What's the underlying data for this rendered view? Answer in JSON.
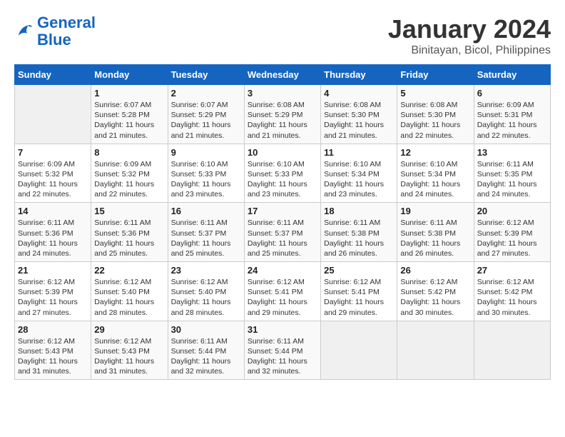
{
  "header": {
    "logo_line1": "General",
    "logo_line2": "Blue",
    "title": "January 2024",
    "subtitle": "Binitayan, Bicol, Philippines"
  },
  "days_of_week": [
    "Sunday",
    "Monday",
    "Tuesday",
    "Wednesday",
    "Thursday",
    "Friday",
    "Saturday"
  ],
  "weeks": [
    [
      {
        "num": "",
        "content": ""
      },
      {
        "num": "1",
        "content": "Sunrise: 6:07 AM\nSunset: 5:28 PM\nDaylight: 11 hours\nand 21 minutes."
      },
      {
        "num": "2",
        "content": "Sunrise: 6:07 AM\nSunset: 5:29 PM\nDaylight: 11 hours\nand 21 minutes."
      },
      {
        "num": "3",
        "content": "Sunrise: 6:08 AM\nSunset: 5:29 PM\nDaylight: 11 hours\nand 21 minutes."
      },
      {
        "num": "4",
        "content": "Sunrise: 6:08 AM\nSunset: 5:30 PM\nDaylight: 11 hours\nand 21 minutes."
      },
      {
        "num": "5",
        "content": "Sunrise: 6:08 AM\nSunset: 5:30 PM\nDaylight: 11 hours\nand 22 minutes."
      },
      {
        "num": "6",
        "content": "Sunrise: 6:09 AM\nSunset: 5:31 PM\nDaylight: 11 hours\nand 22 minutes."
      }
    ],
    [
      {
        "num": "7",
        "content": "Sunrise: 6:09 AM\nSunset: 5:32 PM\nDaylight: 11 hours\nand 22 minutes."
      },
      {
        "num": "8",
        "content": "Sunrise: 6:09 AM\nSunset: 5:32 PM\nDaylight: 11 hours\nand 22 minutes."
      },
      {
        "num": "9",
        "content": "Sunrise: 6:10 AM\nSunset: 5:33 PM\nDaylight: 11 hours\nand 23 minutes."
      },
      {
        "num": "10",
        "content": "Sunrise: 6:10 AM\nSunset: 5:33 PM\nDaylight: 11 hours\nand 23 minutes."
      },
      {
        "num": "11",
        "content": "Sunrise: 6:10 AM\nSunset: 5:34 PM\nDaylight: 11 hours\nand 23 minutes."
      },
      {
        "num": "12",
        "content": "Sunrise: 6:10 AM\nSunset: 5:34 PM\nDaylight: 11 hours\nand 24 minutes."
      },
      {
        "num": "13",
        "content": "Sunrise: 6:11 AM\nSunset: 5:35 PM\nDaylight: 11 hours\nand 24 minutes."
      }
    ],
    [
      {
        "num": "14",
        "content": "Sunrise: 6:11 AM\nSunset: 5:36 PM\nDaylight: 11 hours\nand 24 minutes."
      },
      {
        "num": "15",
        "content": "Sunrise: 6:11 AM\nSunset: 5:36 PM\nDaylight: 11 hours\nand 25 minutes."
      },
      {
        "num": "16",
        "content": "Sunrise: 6:11 AM\nSunset: 5:37 PM\nDaylight: 11 hours\nand 25 minutes."
      },
      {
        "num": "17",
        "content": "Sunrise: 6:11 AM\nSunset: 5:37 PM\nDaylight: 11 hours\nand 25 minutes."
      },
      {
        "num": "18",
        "content": "Sunrise: 6:11 AM\nSunset: 5:38 PM\nDaylight: 11 hours\nand 26 minutes."
      },
      {
        "num": "19",
        "content": "Sunrise: 6:11 AM\nSunset: 5:38 PM\nDaylight: 11 hours\nand 26 minutes."
      },
      {
        "num": "20",
        "content": "Sunrise: 6:12 AM\nSunset: 5:39 PM\nDaylight: 11 hours\nand 27 minutes."
      }
    ],
    [
      {
        "num": "21",
        "content": "Sunrise: 6:12 AM\nSunset: 5:39 PM\nDaylight: 11 hours\nand 27 minutes."
      },
      {
        "num": "22",
        "content": "Sunrise: 6:12 AM\nSunset: 5:40 PM\nDaylight: 11 hours\nand 28 minutes."
      },
      {
        "num": "23",
        "content": "Sunrise: 6:12 AM\nSunset: 5:40 PM\nDaylight: 11 hours\nand 28 minutes."
      },
      {
        "num": "24",
        "content": "Sunrise: 6:12 AM\nSunset: 5:41 PM\nDaylight: 11 hours\nand 29 minutes."
      },
      {
        "num": "25",
        "content": "Sunrise: 6:12 AM\nSunset: 5:41 PM\nDaylight: 11 hours\nand 29 minutes."
      },
      {
        "num": "26",
        "content": "Sunrise: 6:12 AM\nSunset: 5:42 PM\nDaylight: 11 hours\nand 30 minutes."
      },
      {
        "num": "27",
        "content": "Sunrise: 6:12 AM\nSunset: 5:42 PM\nDaylight: 11 hours\nand 30 minutes."
      }
    ],
    [
      {
        "num": "28",
        "content": "Sunrise: 6:12 AM\nSunset: 5:43 PM\nDaylight: 11 hours\nand 31 minutes."
      },
      {
        "num": "29",
        "content": "Sunrise: 6:12 AM\nSunset: 5:43 PM\nDaylight: 11 hours\nand 31 minutes."
      },
      {
        "num": "30",
        "content": "Sunrise: 6:11 AM\nSunset: 5:44 PM\nDaylight: 11 hours\nand 32 minutes."
      },
      {
        "num": "31",
        "content": "Sunrise: 6:11 AM\nSunset: 5:44 PM\nDaylight: 11 hours\nand 32 minutes."
      },
      {
        "num": "",
        "content": ""
      },
      {
        "num": "",
        "content": ""
      },
      {
        "num": "",
        "content": ""
      }
    ]
  ]
}
